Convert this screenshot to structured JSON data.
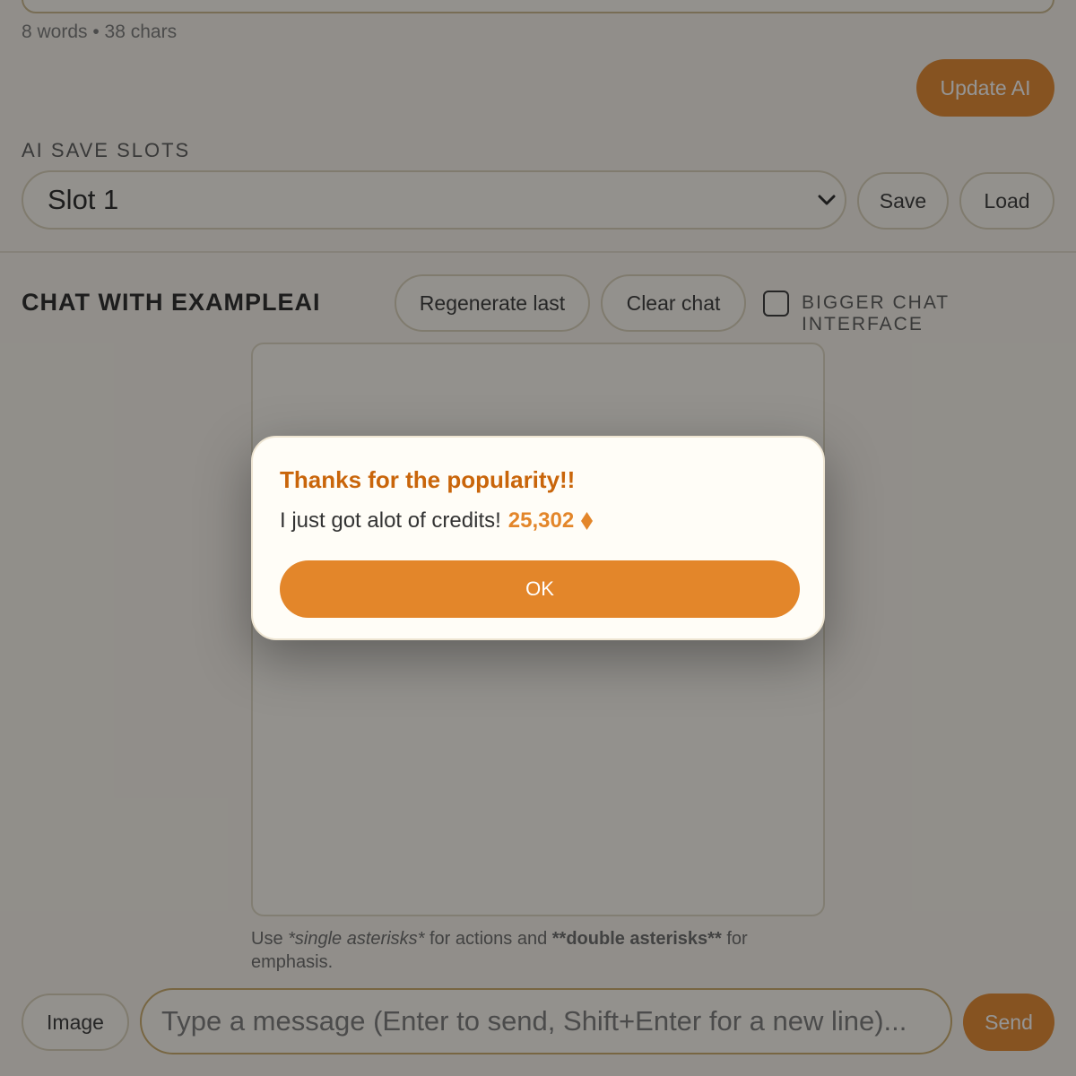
{
  "editor": {
    "counter": "8 words • 38 chars",
    "update_label": "Update AI"
  },
  "save_slots": {
    "label": "AI SAVE SLOTS",
    "selected": "Slot 1",
    "save_label": "Save",
    "load_label": "Load"
  },
  "chat": {
    "title": "CHAT WITH EXAMPLEAI",
    "regenerate_label": "Regenerate last",
    "clear_label": "Clear chat",
    "bigger_label": "BIGGER CHAT INTERFACE",
    "bigger_checked": false,
    "hint": {
      "use": "Use",
      "single": "*single asterisks*",
      "mid": "for actions and",
      "double": "**double asterisks**",
      "end": "for emphasis."
    },
    "image_label": "Image",
    "input_placeholder": "Type a message (Enter to send, Shift+Enter for a new line)...",
    "send_label": "Send"
  },
  "modal": {
    "title": "Thanks for the popularity!!",
    "body": "I just got alot of credits!",
    "credits": "25,302",
    "credit_icon": "diamond-icon",
    "ok_label": "OK"
  },
  "colors": {
    "accent": "#e3862a",
    "title_accent": "#c9650a",
    "overlay": "rgba(25,25,25,0.46)"
  }
}
